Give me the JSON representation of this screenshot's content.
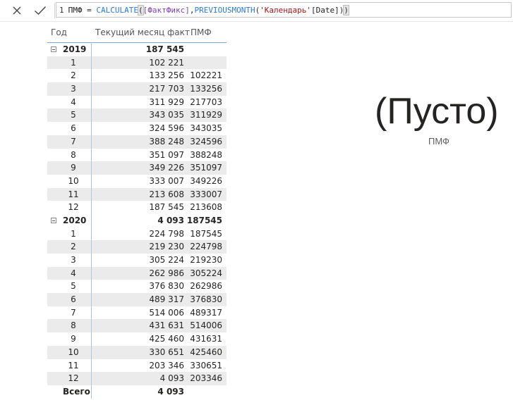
{
  "formula_bar": {
    "cancel_icon": "close-icon",
    "commit_icon": "check-icon",
    "line_number": "1",
    "tokens": [
      {
        "text": "ПМФ = ",
        "kind": "plain"
      },
      {
        "text": "CALCULATE",
        "kind": "fn"
      },
      {
        "text": "(",
        "kind": "br",
        "highlight": true
      },
      {
        "text": "[ФактФикс]",
        "kind": "meas"
      },
      {
        "text": ",",
        "kind": "plain"
      },
      {
        "text": "PREVIOUSMONTH",
        "kind": "fn"
      },
      {
        "text": "(",
        "kind": "br"
      },
      {
        "text": "'Календарь'",
        "kind": "str"
      },
      {
        "text": "[Date]",
        "kind": "plain"
      },
      {
        "text": ")",
        "kind": "br"
      },
      {
        "text": ")",
        "kind": "br",
        "highlight": true
      }
    ]
  },
  "matrix": {
    "headers": {
      "year": "Год",
      "fact": "Текущий месяц факт",
      "pmf": "ПМФ"
    },
    "groups": [
      {
        "year": "2019",
        "fact": "187 545",
        "pmf": "",
        "months": [
          {
            "m": "1",
            "fact": "102 221",
            "pmf": ""
          },
          {
            "m": "2",
            "fact": "133 256",
            "pmf": "102221"
          },
          {
            "m": "3",
            "fact": "217 703",
            "pmf": "133256"
          },
          {
            "m": "4",
            "fact": "311 929",
            "pmf": "217703"
          },
          {
            "m": "5",
            "fact": "343 035",
            "pmf": "311929"
          },
          {
            "m": "6",
            "fact": "324 596",
            "pmf": "343035"
          },
          {
            "m": "7",
            "fact": "388 248",
            "pmf": "324596"
          },
          {
            "m": "8",
            "fact": "351 097",
            "pmf": "388248"
          },
          {
            "m": "9",
            "fact": "349 226",
            "pmf": "351097"
          },
          {
            "m": "10",
            "fact": "333 007",
            "pmf": "349226"
          },
          {
            "m": "11",
            "fact": "213 608",
            "pmf": "333007"
          },
          {
            "m": "12",
            "fact": "187 545",
            "pmf": "213608"
          }
        ]
      },
      {
        "year": "2020",
        "fact": "4 093",
        "pmf": "187545",
        "months": [
          {
            "m": "1",
            "fact": "224 798",
            "pmf": "187545"
          },
          {
            "m": "2",
            "fact": "219 230",
            "pmf": "224798"
          },
          {
            "m": "3",
            "fact": "305 224",
            "pmf": "219230"
          },
          {
            "m": "4",
            "fact": "262 986",
            "pmf": "305224"
          },
          {
            "m": "5",
            "fact": "376 830",
            "pmf": "262986"
          },
          {
            "m": "6",
            "fact": "489 317",
            "pmf": "376830"
          },
          {
            "m": "7",
            "fact": "514 006",
            "pmf": "489317"
          },
          {
            "m": "8",
            "fact": "431 631",
            "pmf": "514006"
          },
          {
            "m": "9",
            "fact": "425 460",
            "pmf": "431631"
          },
          {
            "m": "10",
            "fact": "330 651",
            "pmf": "425460"
          },
          {
            "m": "11",
            "fact": "203 346",
            "pmf": "330651"
          },
          {
            "m": "12",
            "fact": "4 093",
            "pmf": "203346"
          }
        ]
      }
    ],
    "total": {
      "label": "Всего",
      "fact": "4 093",
      "pmf": ""
    }
  },
  "card": {
    "value": "(Пусто)",
    "label": "ПМФ"
  }
}
